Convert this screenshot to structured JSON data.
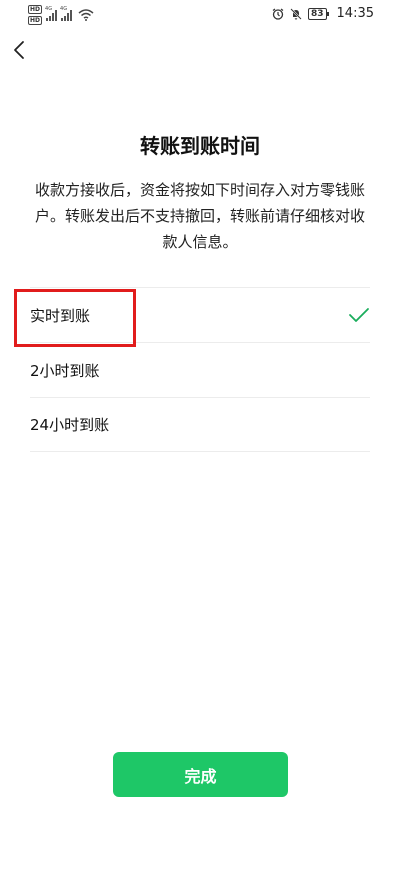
{
  "status_bar": {
    "hd1": "HD",
    "hd2": "HD",
    "net1": "4G",
    "net2": "4G",
    "battery": "83",
    "time": "14:35"
  },
  "page": {
    "title": "转账到账时间",
    "description": "收款方接收后，资金将按如下时间存入对方零钱账户。转账发出后不支持撤回，转账前请仔细核对收款人信息。"
  },
  "options": [
    {
      "label": "实时到账",
      "selected": true
    },
    {
      "label": "2小时到账",
      "selected": false
    },
    {
      "label": "24小时到账",
      "selected": false
    }
  ],
  "done_button": {
    "label": "完成"
  },
  "colors": {
    "accent": "#1ec767",
    "check": "#1aad5c",
    "highlight": "#e11c1c"
  }
}
